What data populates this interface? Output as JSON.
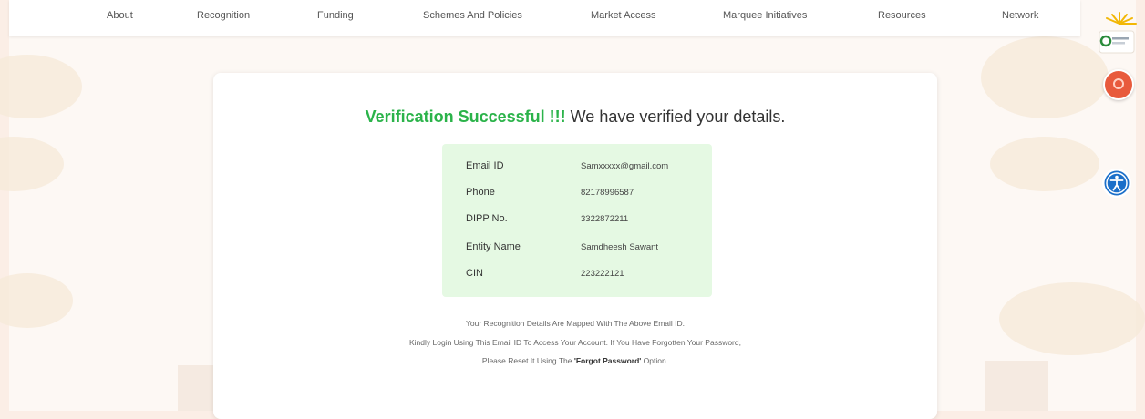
{
  "nav": {
    "items": [
      "About",
      "Recognition",
      "Funding",
      "Schemes And Policies",
      "Market Access",
      "Marquee Initiatives",
      "Resources",
      "Network"
    ]
  },
  "icons": {
    "logo": "startup-india-logo-icon",
    "avatar": "user-avatar-icon",
    "accessibility": "accessibility-icon"
  },
  "colors": {
    "success": "#2bb34a",
    "details_bg": "#e5f9e3",
    "avatar": "#e85a3c",
    "accessibility": "#1b6fc9"
  },
  "verification": {
    "success_text": "Verification Successful !!!",
    "message": "We have verified your details.",
    "details": [
      {
        "label": "Email ID",
        "value": "Samxxxxx@gmail.com"
      },
      {
        "label": "Phone",
        "value": "82178996587"
      },
      {
        "label": "DIPP No.",
        "value": "3322872211"
      },
      {
        "label": "Entity Name",
        "value": "Samdheesh Sawant"
      },
      {
        "label": "CIN",
        "value": "223222121"
      }
    ],
    "info_line1": "Your Recognition Details Are Mapped With The Above Email ID.",
    "info_line2": "Kindly Login Using This Email ID To Access Your Account. If You Have Forgotten Your Password,",
    "info_line3_pre": "Please Reset It Using The ",
    "info_line3_bold": "'Forgot Password'",
    "info_line3_post": " Option."
  }
}
